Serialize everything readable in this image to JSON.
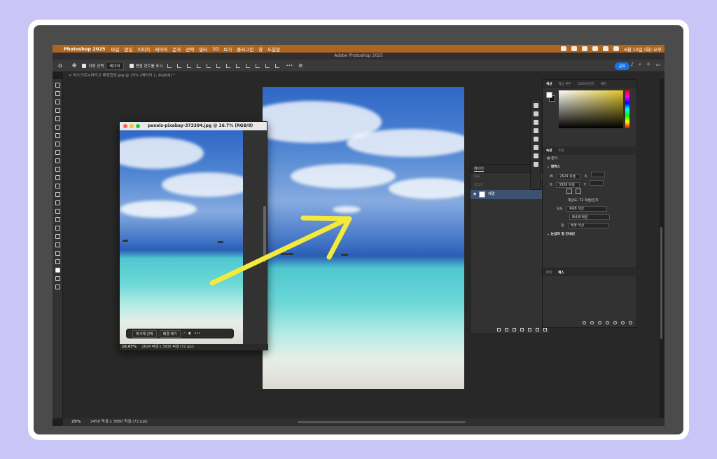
{
  "macos_menubar": {
    "app_name": "Photoshop 2025",
    "menus": [
      "파일",
      "편집",
      "이미지",
      "레이어",
      "문자",
      "선택",
      "필터",
      "3D",
      "보기",
      "플러그인",
      "창",
      "도움말"
    ],
    "clock": "6월 10일 (화) 오후"
  },
  "window": {
    "title": "Adobe Photoshop 2025"
  },
  "options_bar": {
    "auto_select_label": "자동 선택",
    "auto_select_target": "레이어",
    "show_transform_label": "변형 컨트롤 표시",
    "more": "•••",
    "share_label": "공유"
  },
  "document_tab": {
    "label": "× 피스크로누마리고 배경합성.jpg @ 25% (레이어 1, RGB/8) *"
  },
  "floating_window": {
    "title": "pexels-pixabay-373394.jpg @ 16.7% (RGB/8)",
    "context_bar": {
      "select_subject": "피사체 선택",
      "remove_bg": "배경 제거",
      "more": "•••"
    },
    "status": {
      "zoom": "16.67%",
      "info": "2624 픽셀 x 3936 픽셀 (72 ppi)"
    }
  },
  "status_bar": {
    "zoom": "25%",
    "info": "2458 픽셀 x 3680 픽셀 (72 ppi)"
  },
  "layers_panel": {
    "tab": "레이어",
    "kind_label": "종류",
    "blend_label": "표준",
    "opacity_label": "불투명도",
    "lock_label": "잠그기",
    "fill_label": "칠",
    "layer_name": "배경"
  },
  "color_panel": {
    "tabs": [
      "색상",
      "색상 견본",
      "그레이디언트",
      "패턴"
    ]
  },
  "properties_panel": {
    "tabs": [
      "속성",
      "조정"
    ],
    "doc_label": "문서",
    "canvas_section": "캔버스",
    "width_label": "W",
    "width_value": "2624 픽셀",
    "height_label": "H",
    "height_value": "3936 픽셀",
    "x_label": "X",
    "y_label": "Y",
    "resolution": "해상도: 72 픽셀/인치",
    "mode_label": "모드",
    "mode_value": "RGB 색상",
    "bit_value": "8비트/채널",
    "fill_label": "칠",
    "fill_value": "배경 색상",
    "rulers_section": "눈금자 및 안내선"
  },
  "navigator_panel": {
    "tabs": [
      "패널",
      "패스"
    ]
  },
  "colors": {
    "menubar": "#b0651f",
    "arrow": "#f5ea3c",
    "accent": "#1473e6"
  }
}
